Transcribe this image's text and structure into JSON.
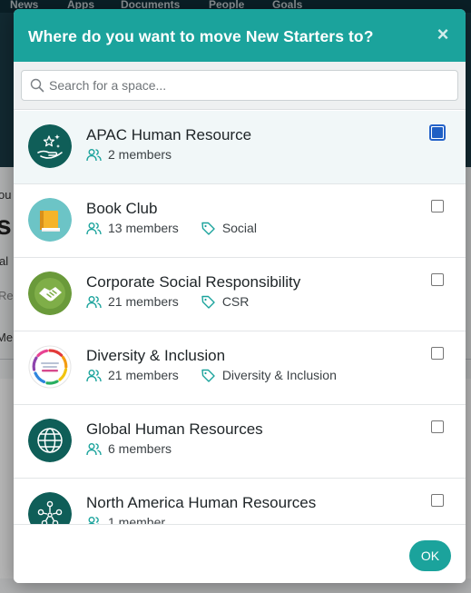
{
  "background": {
    "nav": [
      "News",
      "Apps",
      "Documents",
      "People",
      "Goals"
    ],
    "fragments": [
      "ou",
      "s",
      "al",
      "Re",
      "Me"
    ]
  },
  "modal": {
    "title": "Where do you want to move New Starters to?",
    "close_label": "×",
    "search": {
      "placeholder": "Search for a space...",
      "value": ""
    },
    "spaces": [
      {
        "name": "APAC Human Resource",
        "members": "2 members",
        "tag": null,
        "avatar": "hand-stars-icon",
        "selected": true
      },
      {
        "name": "Book Club",
        "members": "13 members",
        "tag": "Social",
        "avatar": "book-icon",
        "selected": false
      },
      {
        "name": "Corporate Social Responsibility",
        "members": "21 members",
        "tag": "CSR",
        "avatar": "handshake-icon",
        "selected": false
      },
      {
        "name": "Diversity & Inclusion",
        "members": "21 members",
        "tag": "Diversity & Inclusion",
        "avatar": "diversity-logo-icon",
        "selected": false
      },
      {
        "name": "Global Human Resources",
        "members": "6 members",
        "tag": null,
        "avatar": "globe-icon",
        "selected": false
      },
      {
        "name": "North America Human Resources",
        "members": "1 member",
        "tag": null,
        "avatar": "people-network-icon",
        "selected": false
      }
    ],
    "ok_label": "OK"
  },
  "colors": {
    "accent": "#1ba39c",
    "avatar_dark": "#0f5e58",
    "checkbox_checked": "#1f5fc4"
  }
}
